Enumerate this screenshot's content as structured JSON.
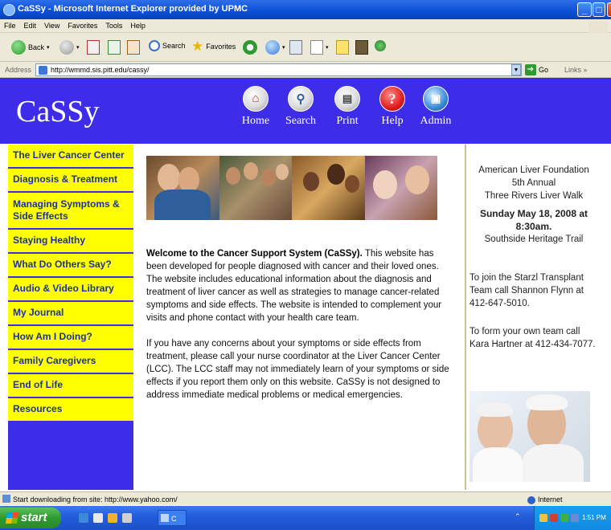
{
  "window": {
    "title": "CaSSy - Microsoft Internet Explorer provided by UPMC",
    "minimize": "_",
    "maximize": "□",
    "close": "x"
  },
  "menu": [
    "File",
    "Edit",
    "View",
    "Favorites",
    "Tools",
    "Help"
  ],
  "toolbar": {
    "back": "Back",
    "search": "Search",
    "favorites": "Favorites"
  },
  "address_bar": {
    "label": "Address",
    "url": "http://wmmd.sis.pitt.edu/cassy/",
    "go": "Go",
    "links": "Links"
  },
  "site": {
    "logo": "CaSSy",
    "header_nav": [
      {
        "label": "Home",
        "icon": "home-icon"
      },
      {
        "label": "Search",
        "icon": "search-icon"
      },
      {
        "label": "Print",
        "icon": "print-icon"
      },
      {
        "label": "Help",
        "icon": "help-icon"
      },
      {
        "label": "Admin",
        "icon": "admin-icon"
      }
    ],
    "header_color": "#3d2de8",
    "nav_color": "#ffff00"
  },
  "left_nav": [
    "The Liver Cancer Center",
    "Diagnosis & Treatment",
    "Managing Symptoms & Side Effects",
    "Staying Healthy",
    "What Do Others Say?",
    "Audio & Video Library",
    "My Journal",
    "How Am I Doing?",
    "Family Caregivers",
    "End of Life",
    "Resources"
  ],
  "main": {
    "welcome_bold": "Welcome to the Cancer Support System (CaSSy).",
    "welcome_rest": " This website has been developed for people diagnosed with cancer and their loved ones. The website includes educational information about the diagnosis and treatment of liver cancer as well as strategies to manage cancer-related symptoms and side effects. The website is intended to complement your visits and phone contact with your health care team.",
    "concerns": "If you have any concerns about your symptoms or side effects from treatment, please call your nurse coordinator at the Liver Cancer Center (LCC). The LCC staff may not immediately learn of your symptoms or side effects if you report them only on this website. CaSSy is not designed to address immediate medical problems or medical emergencies."
  },
  "right_col": {
    "line1": "American Liver Foundation",
    "line2": "5th Annual",
    "line3": "Three Rivers Liver Walk",
    "date": "Sunday May 18, 2008 at 8:30am.",
    "location": "Southside Heritage Trail",
    "join": "To join the Starzl Transplant Team call Shannon Flynn at 412-647-5010.",
    "form": "To form your own team call Kara Hartner at 412-434-7077."
  },
  "status_bar": {
    "text": "Start downloading from site: http://www.yahoo.com/",
    "zone": "Internet"
  },
  "taskbar": {
    "start": "start",
    "task": "C",
    "clock": "1:51 PM"
  }
}
